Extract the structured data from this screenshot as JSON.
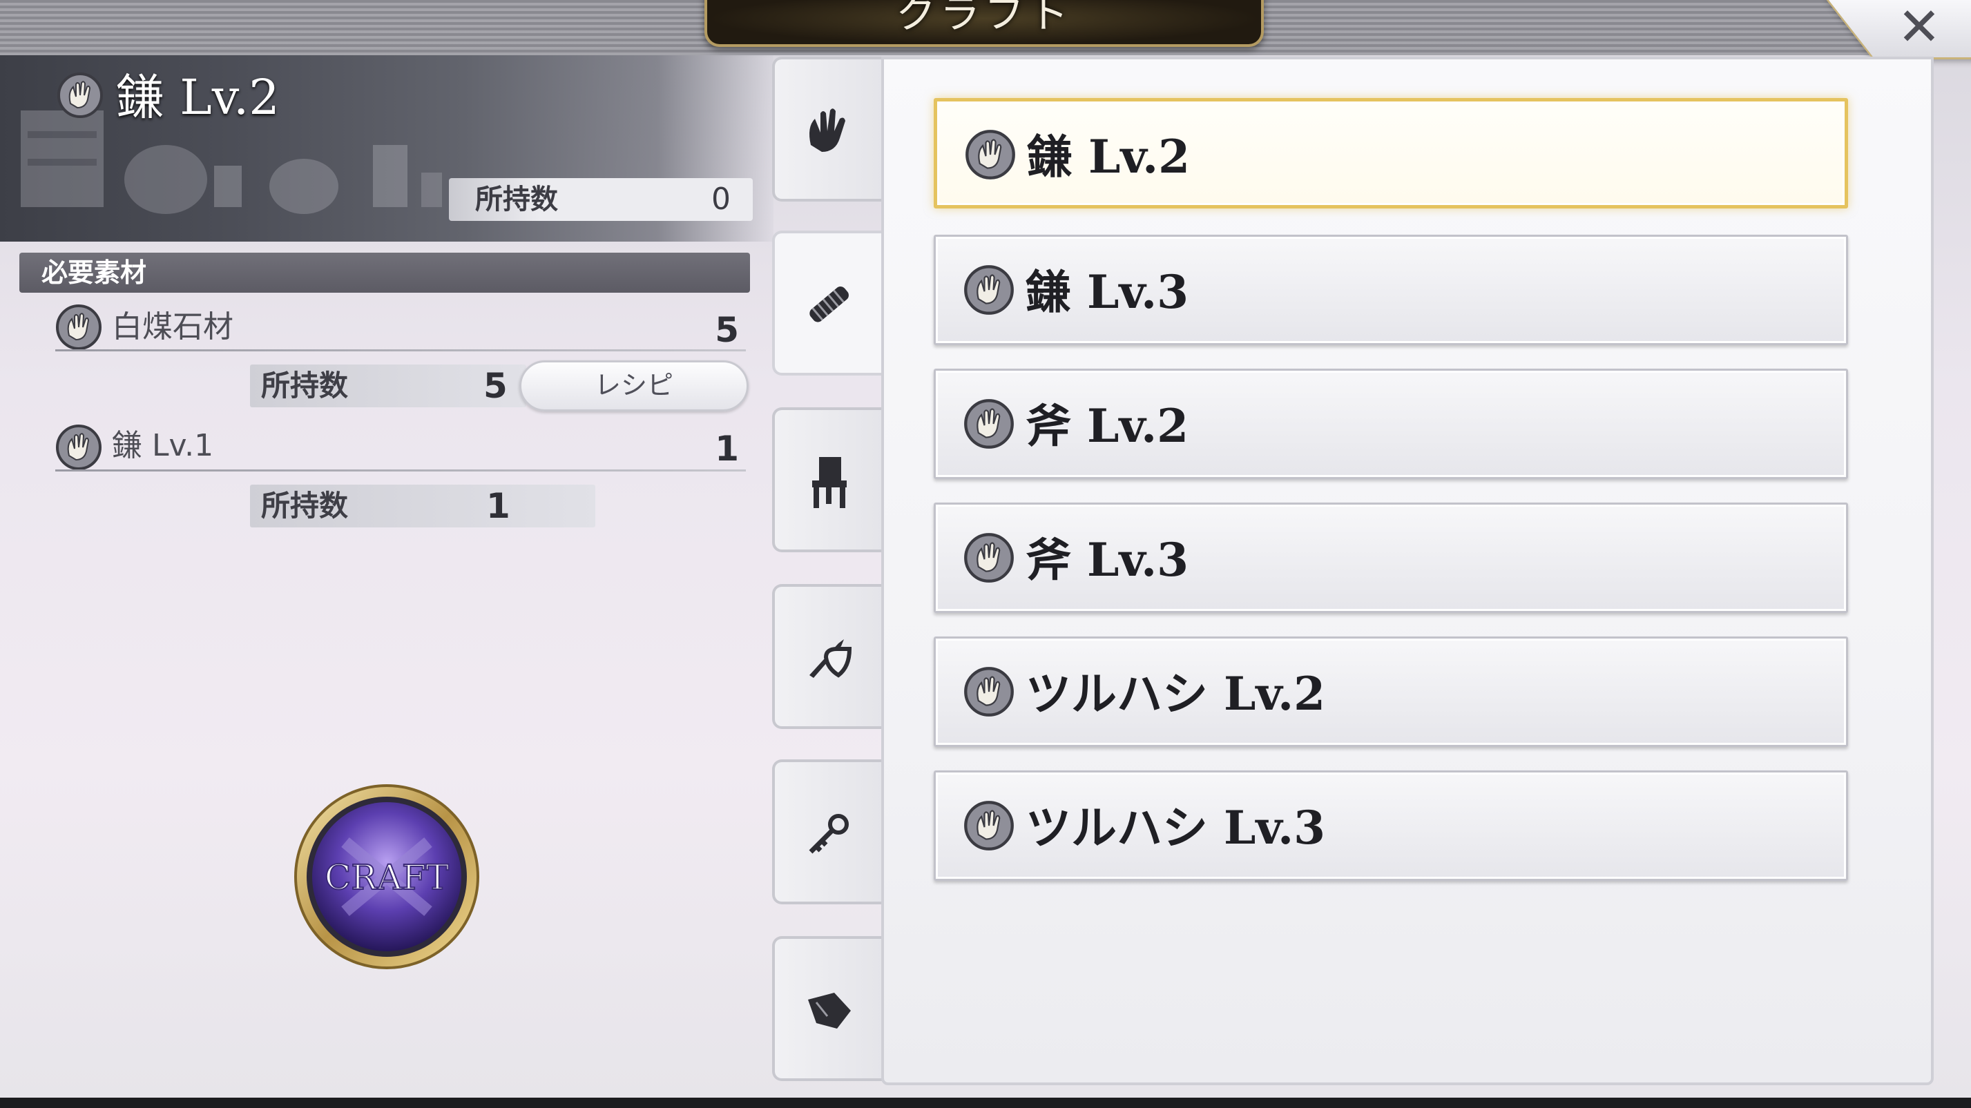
{
  "window": {
    "title": "クラフト"
  },
  "close": {
    "icon": "close-icon",
    "glyph": "✕"
  },
  "selected_item": {
    "icon": "hand-icon",
    "name": "鎌 Lv.2",
    "owned_label": "所持数",
    "owned_value": "0"
  },
  "materials": {
    "header": "必要素材",
    "items": [
      {
        "icon": "hand-icon",
        "name": "白煤石材",
        "required": "5",
        "owned_label": "所持数",
        "owned_value": "5",
        "recipe_label": "レシピ"
      },
      {
        "icon": "hand-icon",
        "name": "鎌 Lv.1",
        "required": "1",
        "owned_label": "所持数",
        "owned_value": "1"
      }
    ]
  },
  "craft_button": {
    "label": "CRAFT"
  },
  "categories": [
    {
      "icon": "glove-icon",
      "active": false
    },
    {
      "icon": "tool-icon",
      "active": true
    },
    {
      "icon": "chair-icon",
      "active": false
    },
    {
      "icon": "sword-shield-icon",
      "active": false
    },
    {
      "icon": "key-icon",
      "active": false
    },
    {
      "icon": "cloth-icon",
      "active": false
    }
  ],
  "recipe_list": [
    {
      "label": "鎌 Lv.2",
      "icon": "hand-icon",
      "selected": true
    },
    {
      "label": "鎌 Lv.3",
      "icon": "hand-icon",
      "selected": false
    },
    {
      "label": "斧 Lv.2",
      "icon": "hand-icon",
      "selected": false
    },
    {
      "label": "斧 Lv.3",
      "icon": "hand-icon",
      "selected": false
    },
    {
      "label": "ツルハシ Lv.2",
      "icon": "hand-icon",
      "selected": false
    },
    {
      "label": "ツルハシ Lv.3",
      "icon": "hand-icon",
      "selected": false
    }
  ],
  "colors": {
    "selected_border": "#e5c35f",
    "title_tab_border": "#b49b62"
  }
}
